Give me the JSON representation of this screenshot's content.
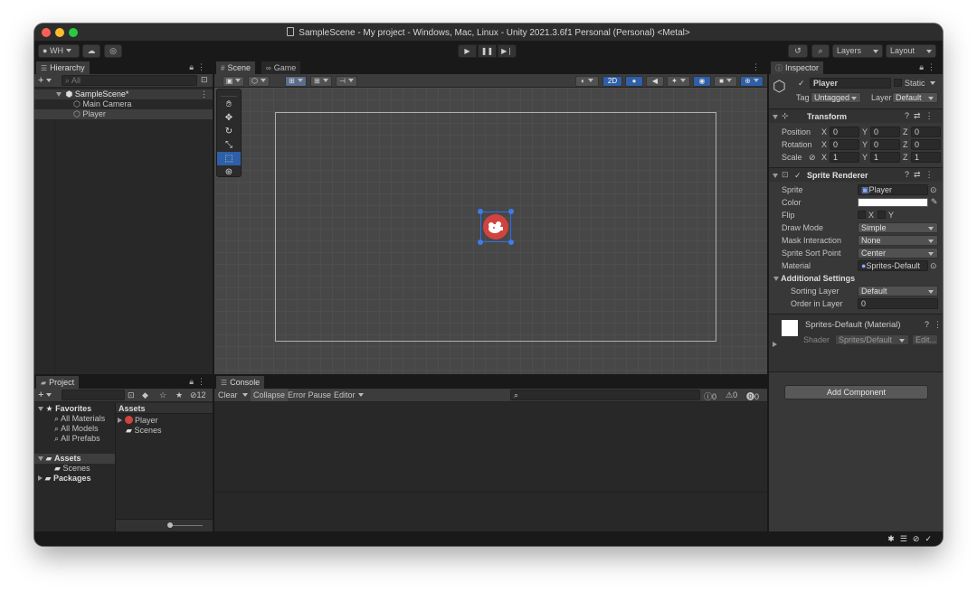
{
  "window": {
    "title": "SampleScene - My project - Windows, Mac, Linux - Unity 2021.3.6f1 Personal (Personal) <Metal>"
  },
  "toolbar": {
    "account": "WH",
    "layers": "Layers",
    "layout": "Layout",
    "play": "▶",
    "pause": "❚❚",
    "step": "▶❘"
  },
  "hierarchy": {
    "tab": "Hierarchy",
    "search_placeholder": "All",
    "scene": "SampleScene*",
    "items": [
      "Main Camera",
      "Player"
    ]
  },
  "scene_view": {
    "tabs": [
      "Scene",
      "Game"
    ],
    "mode_2d": "2D"
  },
  "project": {
    "tab": "Project",
    "hidden_count": "12",
    "favorites": "Favorites",
    "favorite_items": [
      "All Materials",
      "All Models",
      "All Prefabs"
    ],
    "assets": "Assets",
    "asset_folders": [
      "Scenes"
    ],
    "packages": "Packages",
    "assets_header": "Assets",
    "asset_items": [
      "Player",
      "Scenes"
    ]
  },
  "console": {
    "tab": "Console",
    "clear": "Clear",
    "collapse": "Collapse",
    "error_pause": "Error Pause",
    "editor": "Editor",
    "log_count": "0",
    "warn_count": "0",
    "error_count": "0"
  },
  "inspector": {
    "tab": "Inspector",
    "object_name": "Player",
    "static_label": "Static",
    "tag_label": "Tag",
    "tag_value": "Untagged",
    "layer_label": "Layer",
    "layer_value": "Default",
    "transform": {
      "title": "Transform",
      "rows": [
        {
          "label": "Position",
          "x": "0",
          "y": "0",
          "z": "0"
        },
        {
          "label": "Rotation",
          "x": "0",
          "y": "0",
          "z": "0"
        },
        {
          "label": "Scale",
          "x": "1",
          "y": "1",
          "z": "1"
        }
      ]
    },
    "sprite_renderer": {
      "title": "Sprite Renderer",
      "sprite_label": "Sprite",
      "sprite_value": "Player",
      "color_label": "Color",
      "flip_label": "Flip",
      "flip_x": "X",
      "flip_y": "Y",
      "draw_mode_label": "Draw Mode",
      "draw_mode_value": "Simple",
      "mask_label": "Mask Interaction",
      "mask_value": "None",
      "sort_point_label": "Sprite Sort Point",
      "sort_point_value": "Center",
      "material_label": "Material",
      "material_value": "Sprites-Default",
      "additional_settings": "Additional Settings",
      "sorting_layer_label": "Sorting Layer",
      "sorting_layer_value": "Default",
      "order_label": "Order in Layer",
      "order_value": "0"
    },
    "material": {
      "title": "Sprites-Default (Material)",
      "shader_label": "Shader",
      "shader_value": "Sprites/Default",
      "edit": "Edit..."
    },
    "add_component": "Add Component"
  },
  "colors": {
    "accent_blue": "#3d7de8",
    "player_red": "#d0433f",
    "close": "#fe5f57",
    "minimize": "#febb2e",
    "maximize": "#28c840"
  }
}
